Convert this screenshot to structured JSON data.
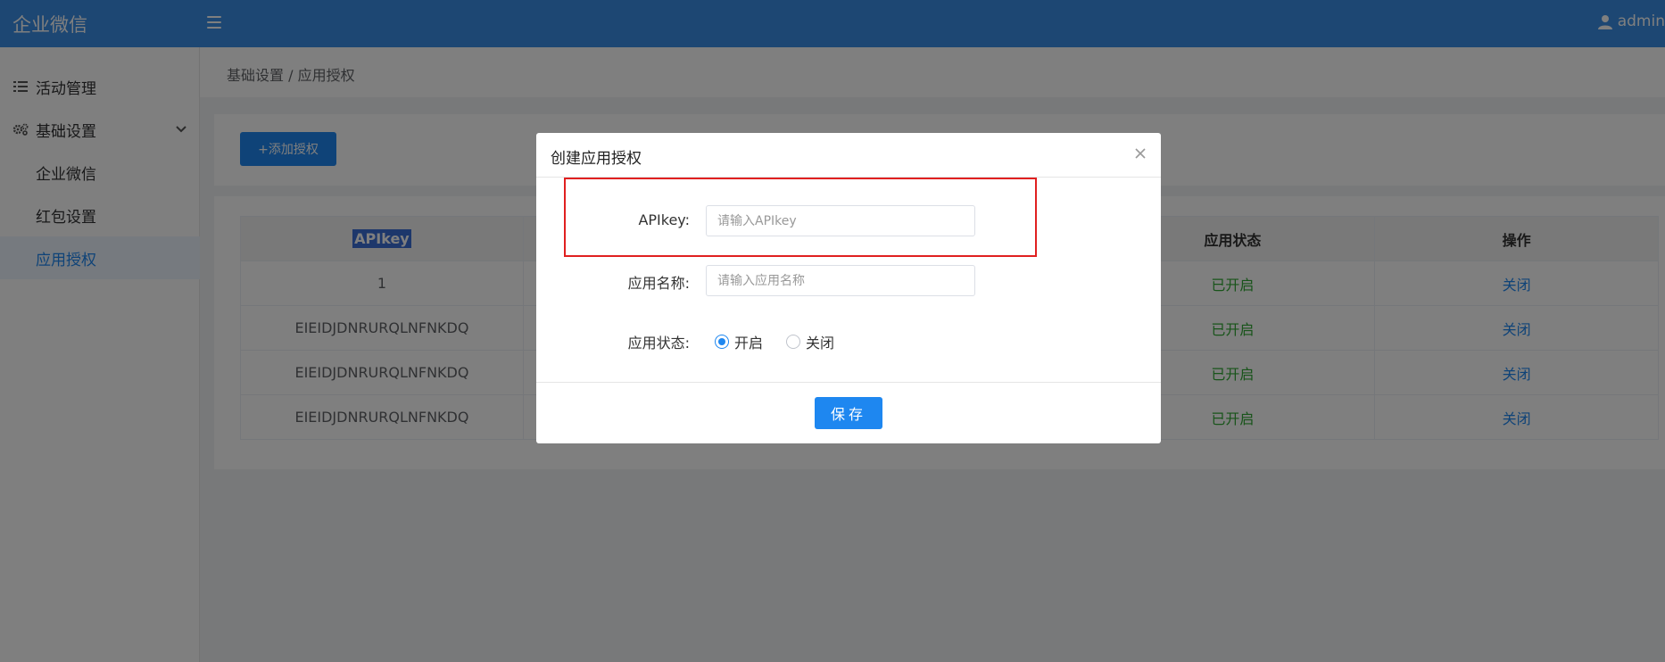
{
  "app": {
    "brand": "企业微信",
    "user": "admin"
  },
  "sidebar": {
    "items": [
      {
        "label": "活动管理",
        "icon": "list-icon"
      },
      {
        "label": "基础设置",
        "icon": "gears-icon"
      }
    ],
    "subitems": [
      {
        "label": "企业微信"
      },
      {
        "label": "红包设置"
      },
      {
        "label": "应用授权",
        "active": true
      }
    ]
  },
  "breadcrumb": "基础设置 / 应用授权",
  "toolbar": {
    "add_label": "+添加授权"
  },
  "table": {
    "headers": [
      "APIkey",
      "应用状态",
      "操作"
    ],
    "rows": [
      {
        "apikey": "1",
        "status": "已开启",
        "action": "关闭"
      },
      {
        "apikey": "EIEIDJDNRURQLNFNKDQ",
        "status": "已开启",
        "action": "关闭"
      },
      {
        "apikey": "EIEIDJDNRURQLNFNKDQ",
        "status": "已开启",
        "action": "关闭"
      },
      {
        "apikey": "EIEIDJDNRURQLNFNKDQ",
        "status": "已开启",
        "action": "关闭"
      }
    ]
  },
  "modal": {
    "title": "创建应用授权",
    "apikey_label": "APIkey:",
    "apikey_placeholder": "请输入APIkey",
    "appname_label": "应用名称:",
    "appname_placeholder": "请输入应用名称",
    "status_label": "应用状态:",
    "status_on": "开启",
    "status_off": "关闭",
    "save_label": "保存"
  },
  "colors": {
    "primary": "#1e87f0",
    "header": "#3a8ee6",
    "success": "#31a834",
    "highlight": "#e02020"
  }
}
